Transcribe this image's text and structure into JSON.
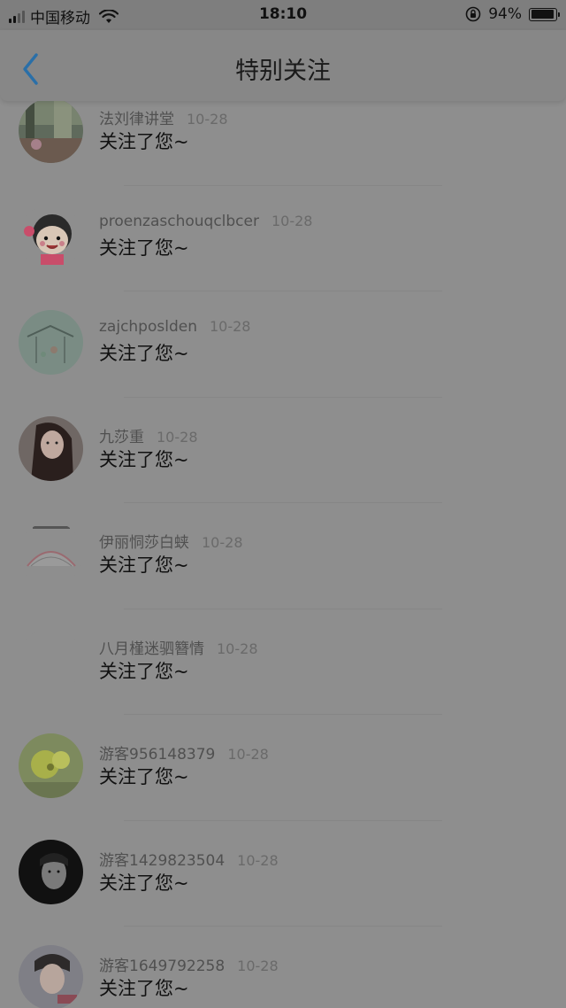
{
  "status_bar": {
    "carrier": "中国移动",
    "time": "18:10",
    "battery": "94%"
  },
  "nav": {
    "title": "特别关注"
  },
  "items": [
    {
      "name": "法刘律讲堂",
      "date": "10-28",
      "message": "关注了您~"
    },
    {
      "name": "proenzaschouqclbcer",
      "date": "10-28",
      "message": "关注了您~"
    },
    {
      "name": "zajchposlden",
      "date": "10-28",
      "message": "关注了您~"
    },
    {
      "name": "九莎重",
      "date": "10-28",
      "message": "关注了您~"
    },
    {
      "name": "伊丽恫莎白蛱",
      "date": "10-28",
      "message": "关注了您~"
    },
    {
      "name": "八月槿迷驷簪情",
      "date": "10-28",
      "message": "关注了您~"
    },
    {
      "name": "游客956148379",
      "date": "10-28",
      "message": "关注了您~"
    },
    {
      "name": "游客1429823504",
      "date": "10-28",
      "message": "关注了您~"
    },
    {
      "name": "游客1649792258",
      "date": "10-28",
      "message": "关注了您~"
    }
  ],
  "colors": {
    "accent": "#2a6fa8",
    "overlay": "#8e8e8e"
  }
}
